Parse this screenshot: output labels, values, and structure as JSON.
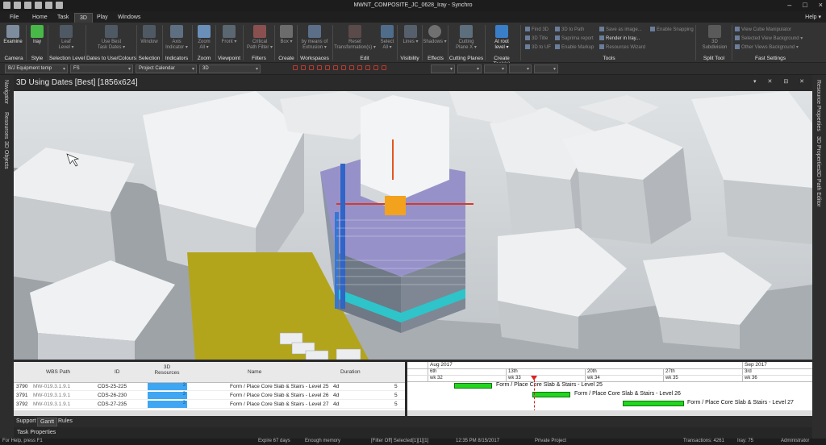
{
  "window": {
    "title": "MWNT_COMPOSITE_JC_0628_Iray - Synchro",
    "minimize": "–",
    "maximize": "□",
    "close": "×"
  },
  "menu": {
    "tabs": [
      "File",
      "Home",
      "Task",
      "3D",
      "Play",
      "Windows"
    ],
    "help": "Help ▾"
  },
  "ribbon": {
    "buttons": [
      {
        "label": "Examine"
      },
      {
        "label": "Iray"
      },
      {
        "label": "Leaf\nLevel ▾"
      },
      {
        "label": "Use Best\nTask Dates ▾"
      },
      {
        "label": "Window"
      },
      {
        "label": "Axis\nIndicator ▾"
      },
      {
        "label": "Zoom\nAll ▾"
      },
      {
        "label": "Front ▾"
      },
      {
        "label": "Critical\nPath Filter ▾"
      },
      {
        "label": "Box ▾"
      },
      {
        "label": "by means of\nExtrusion ▾"
      },
      {
        "label": "Reset\nTransformation(s) ▾"
      },
      {
        "label": "Select\nAll ▾"
      },
      {
        "label": "Lines ▾"
      },
      {
        "label": "Shadows ▾"
      },
      {
        "label": "Cutting\nPlane X ▾"
      },
      {
        "label": "At root\nlevel ▾"
      },
      {
        "label": "3D\nSubdivision"
      }
    ],
    "groups": [
      "Camera",
      "Style",
      "Selection Level",
      "Dates to Use/Colours",
      "Selection",
      "Indicators",
      "Zoom",
      "Viewpoint",
      "Filters",
      "Create",
      "Workspaces",
      "Edit",
      "Visibility",
      "Effects",
      "Cutting Planes",
      "Create Task(s)",
      "Tools",
      "Split Tool",
      "Fast Settings"
    ],
    "tools_small": [
      [
        "Find 3D",
        "3D to Path",
        "Save as image...",
        "Enable Snapping"
      ],
      [
        "3D Title",
        "Saprima report",
        "Render in Iray..."
      ],
      [
        "3D to UF",
        "Enable Markup",
        "Resources Wizard"
      ]
    ],
    "fast_settings": [
      "View Cube Manipulator",
      "Selected View Background ▾",
      "Other Views Background ▾"
    ]
  },
  "filters": {
    "equipment": "B/J Equipment temp",
    "fs": "FS",
    "calendar": "Project Calendar",
    "view": "3D"
  },
  "side_panels": {
    "left": [
      "Navigator",
      "Resources",
      "3D Objects"
    ],
    "right": [
      "Resource Properties",
      "3D Properties",
      "3D Path Editor"
    ]
  },
  "viewport": {
    "title": "3D Using Dates [Best] [1856x624]",
    "controls": "▾ ✕ ⊟ ✕"
  },
  "grid": {
    "columns": [
      "WBS Path",
      "ID",
      "3D Resources",
      "Name",
      "Duration"
    ],
    "rows": [
      {
        "num": "3790",
        "wbs": "MW-019.3.1.9.1",
        "id": "CDS-25-225",
        "res": "3",
        "name": "Form / Place Core Slab & Stairs - Level 25",
        "dur": "4d",
        "extra": "5"
      },
      {
        "num": "3791",
        "wbs": "MW-019.3.1.9.1",
        "id": "CDS-26-230",
        "res": "3",
        "name": "Form / Place Core Slab & Stairs - Level 26",
        "dur": "4d",
        "extra": "5"
      },
      {
        "num": "3792",
        "wbs": "MW-019.3.1.9.1",
        "id": "CDS-27-235",
        "res": "3",
        "name": "Form / Place Core Slab & Stairs - Level 27",
        "dur": "4d",
        "extra": "5"
      }
    ]
  },
  "gantt": {
    "months": [
      "Aug 2017",
      "Sep 2017"
    ],
    "days": [
      "6th",
      "13th",
      "20th",
      "27th",
      "3rd"
    ],
    "weeks": [
      "wk 32",
      "wk 33",
      "wk 34",
      "wk 35",
      "wk 36"
    ],
    "bars": [
      {
        "label": "Form / Place Core Slab & Stairs - Level 25"
      },
      {
        "label": "Form / Place Core Slab & Stairs - Level 26"
      },
      {
        "label": "Form / Place Core Slab & Stairs - Level 27"
      }
    ]
  },
  "bottom_tabs": [
    "Support",
    "Gantt",
    "Rules"
  ],
  "task_properties": "Task Properties",
  "status": {
    "help": "For Help, press F1",
    "expire": "Expire 67 days",
    "memory": "Enough memory",
    "filter": "[Filter Off] Selected[1][1][1]",
    "time": "12:35 PM 8/15/2017",
    "project": "Private Project",
    "transactions": "Transactions: 4261",
    "iray": "Iray: 75",
    "user": "Administrator"
  },
  "colors": {
    "gantt_bar": "#22d51f",
    "resource_bar": "#3ea6f2",
    "today_line": "#e02020",
    "ground_slab": "#b3a51b"
  }
}
